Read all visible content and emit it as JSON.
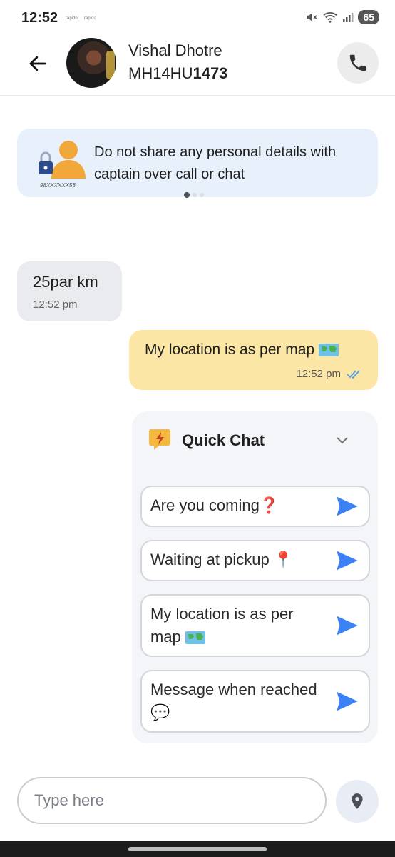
{
  "status_bar": {
    "time": "12:52",
    "mini_left": "rapido",
    "mini_right": "rapido",
    "battery": "65"
  },
  "header": {
    "name": "Vishal Dhotre",
    "plate_prefix": "MH14HU",
    "plate_number": "1473"
  },
  "info_banner": {
    "text": "Do not share any personal details with captain over call or chat",
    "masked_number": "98XXXXXX58"
  },
  "messages": [
    {
      "direction": "incoming",
      "text": "25par km",
      "time": "12:52 pm"
    },
    {
      "direction": "outgoing",
      "text": "My location is as per map",
      "time": "12:52 pm",
      "status": "read"
    }
  ],
  "quick_chat": {
    "title": "Quick Chat",
    "options": [
      {
        "label": "Are you coming❓"
      },
      {
        "label": "Waiting at pickup 📍"
      },
      {
        "label": "My location is as per map"
      },
      {
        "label": "Message when reached 💬"
      }
    ]
  },
  "composer": {
    "placeholder": "Type here"
  },
  "colors": {
    "outgoing_bubble": "#fbe6a6",
    "incoming_bubble": "#eaebef",
    "banner": "#e8f0fc",
    "send_icon": "#3b82f6"
  }
}
